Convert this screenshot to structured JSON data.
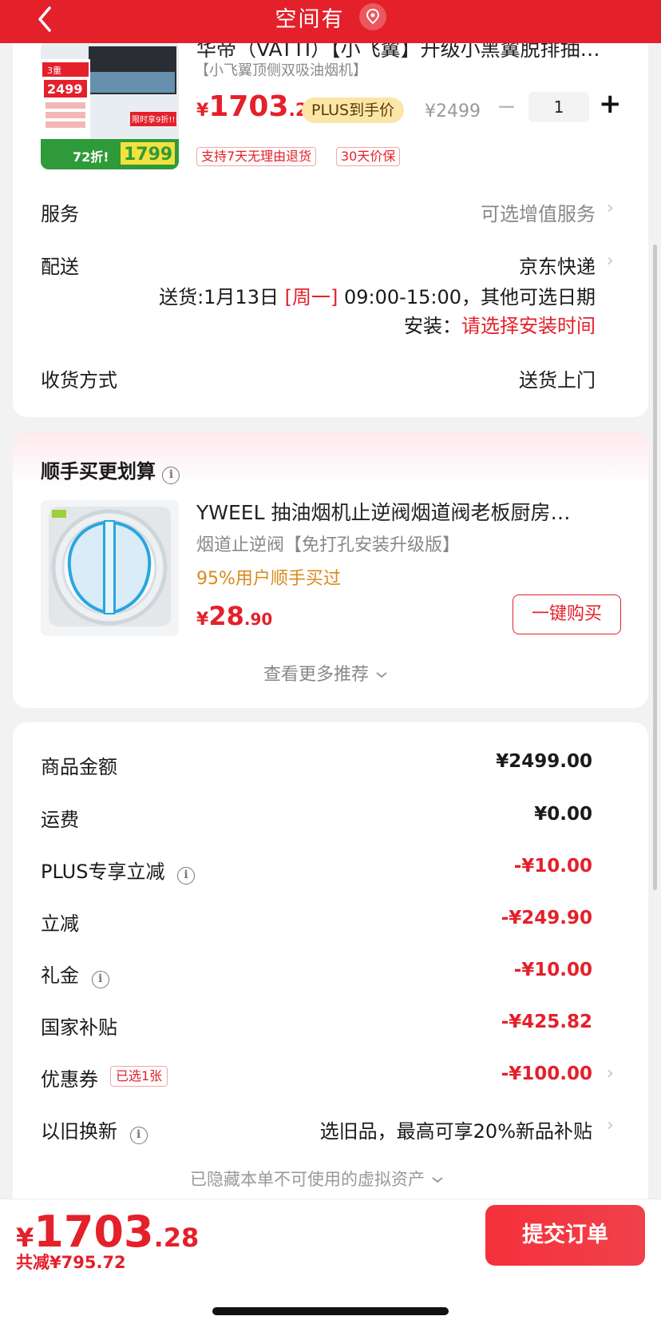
{
  "header": {
    "title": "空间有",
    "back_icon": "chevron-left-icon",
    "location_icon": "location-pin-icon",
    "bg_color": "#e4202a"
  },
  "product": {
    "title": "华帝（VATTI）【小飞翼】升级小黑翼脱排抽油…",
    "subtitle": "【小飞翼顶侧双吸油烟机】",
    "price_symbol": "¥",
    "price_int": "1703",
    "price_dec": ".28",
    "plus_tag": "PLUS到手价",
    "original_price": "¥2499",
    "quantity": "1",
    "minus_label": "−",
    "plus_label": "+",
    "tags": [
      "支持7天无理由退货",
      "30天价保"
    ],
    "image": {
      "badge1": "3重",
      "badge2": "2499",
      "bottom_price": "1799",
      "promo": "72折!",
      "label_right": "限时享9折!!!"
    }
  },
  "service": {
    "label": "服务",
    "value": "可选增值服务"
  },
  "delivery": {
    "label": "配送",
    "value": "京东快递",
    "date_prefix": "送货:1月13日",
    "weekday": "[周一]",
    "time_suffix": "09:00-15:00，其他可选日期",
    "install_label": "安装：",
    "install_value": "请选择安装时间"
  },
  "receive": {
    "label": "收货方式",
    "value": "送货上门"
  },
  "recommend": {
    "section_title": "顺手买更划算",
    "item_title": "YWEEL 抽油烟机止逆阀烟道阀老板厨房…",
    "item_sub": "烟道止逆阀【免打孔安装升级版】",
    "item_note": "95%用户顺手买过",
    "price_symbol": "¥",
    "price_int": "28",
    "price_dec": ".90",
    "buy_button": "一键购买",
    "more_label": "查看更多推荐"
  },
  "summary": {
    "rows": [
      {
        "label": "商品金额",
        "value": "¥2499.00"
      },
      {
        "label": "运费",
        "value": "¥0.00"
      },
      {
        "label": "PLUS专享立减",
        "value": "-¥10.00"
      },
      {
        "label": "立减",
        "value": "-¥249.90"
      },
      {
        "label": "礼金",
        "value": "-¥10.00"
      },
      {
        "label": "国家补贴",
        "value": "-¥425.82"
      },
      {
        "label": "优惠券",
        "value": "-¥100.00",
        "badge": "已选1张"
      },
      {
        "label": "以旧换新",
        "value": "选旧品，最高可享20%新品补贴"
      }
    ],
    "hidden_assets": "已隐藏本单不可使用的虚拟资产"
  },
  "footer": {
    "price_symbol": "¥",
    "price_int": "1703",
    "price_dec": ".28",
    "saved": "共减¥795.72",
    "submit": "提交订单"
  }
}
